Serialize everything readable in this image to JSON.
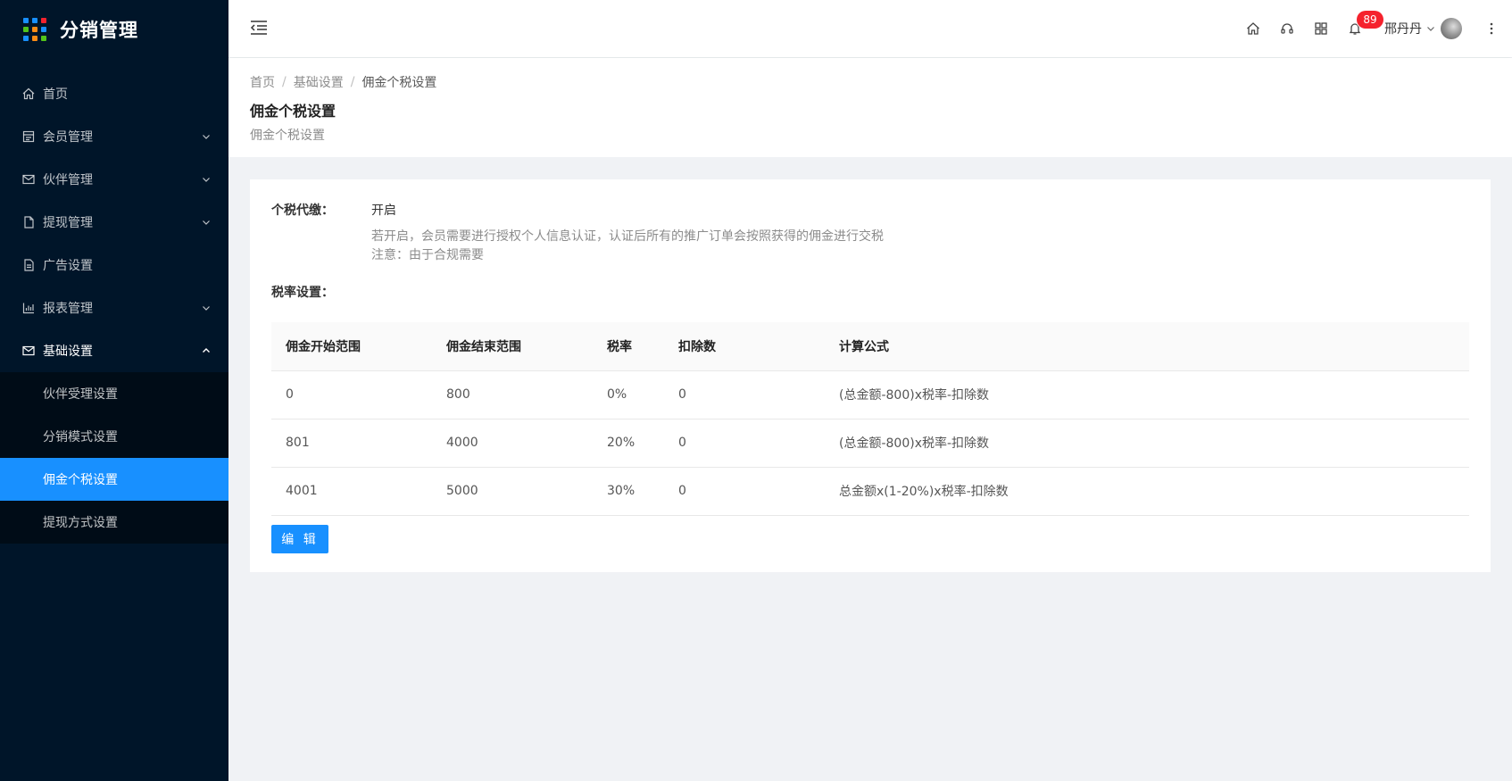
{
  "app": {
    "title": "分销管理",
    "logo_colors": [
      "#1890ff",
      "#1890ff",
      "#f5222d",
      "#52c41a",
      "#fa8c16",
      "#1890ff",
      "#1890ff",
      "#fa8c16",
      "#52c41a"
    ]
  },
  "sidebar": {
    "items": [
      {
        "label": "首页",
        "icon": "home-icon"
      },
      {
        "label": "会员管理",
        "icon": "member-icon"
      },
      {
        "label": "伙伴管理",
        "icon": "mail-icon"
      },
      {
        "label": "提现管理",
        "icon": "file-icon"
      },
      {
        "label": "广告设置",
        "icon": "file-text-icon"
      },
      {
        "label": "报表管理",
        "icon": "bar-chart-icon"
      },
      {
        "label": "基础设置",
        "icon": "mail-icon"
      }
    ],
    "submenu": [
      {
        "label": "伙伴受理设置"
      },
      {
        "label": "分销模式设置"
      },
      {
        "label": "佣金个税设置"
      },
      {
        "label": "提现方式设置"
      }
    ],
    "accent_color": "#1890ff"
  },
  "header": {
    "notification_count": "89",
    "user_name": "邢丹丹"
  },
  "page": {
    "breadcrumb": [
      "首页",
      "基础设置",
      "佣金个税设置"
    ],
    "title": "佣金个税设置",
    "description": "佣金个税设置"
  },
  "form": {
    "tax_label": "个税代缴：",
    "tax_value": "开启",
    "help_line1": "若开启，会员需要进行授权个人信息认证，认证后所有的推广订单会按照获得的佣金进行交税",
    "help_line2": "注意：由于合规需要",
    "rate_label": "税率设置："
  },
  "table": {
    "columns": [
      "佣金开始范围",
      "佣金结束范围",
      "税率",
      "扣除数",
      "计算公式"
    ],
    "rows": [
      [
        "0",
        "800",
        "0%",
        "0",
        "(总金额-800)x税率-扣除数"
      ],
      [
        "801",
        "4000",
        "20%",
        "0",
        "(总金额-800)x税率-扣除数"
      ],
      [
        "4001",
        "5000",
        "30%",
        "0",
        "总金额x(1-20%)x税率-扣除数"
      ]
    ]
  },
  "actions": {
    "edit_label": "编 辑"
  }
}
